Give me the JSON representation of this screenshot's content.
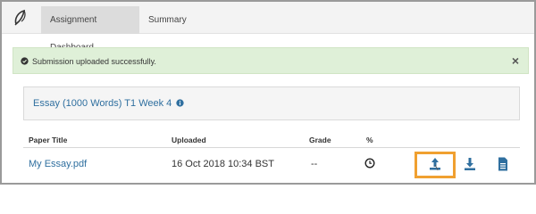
{
  "tabs": [
    {
      "label": "Assignment Dashboard"
    },
    {
      "label": "Summary"
    }
  ],
  "alert": {
    "message": "Submission uploaded successfully.",
    "close_label": "×",
    "color": "#dff0d8"
  },
  "assignment": {
    "title": "Essay (1000 Words) T1 Week 4"
  },
  "table": {
    "headers": {
      "paper_title": "Paper Title",
      "uploaded": "Uploaded",
      "grade": "Grade",
      "percent": "%"
    },
    "rows": [
      {
        "paper_title": "My Essay.pdf",
        "uploaded": "16 Oct 2018 10:34 BST",
        "grade": "--"
      }
    ]
  },
  "icons": {
    "logo": "quill-logo-icon",
    "check": "check-circle-icon",
    "info": "info-circle-icon",
    "clock": "clock-icon",
    "upload": "upload-icon",
    "download": "download-icon",
    "document": "document-icon"
  },
  "colors": {
    "link": "#2f6f9f",
    "highlight": "#f0a030"
  }
}
